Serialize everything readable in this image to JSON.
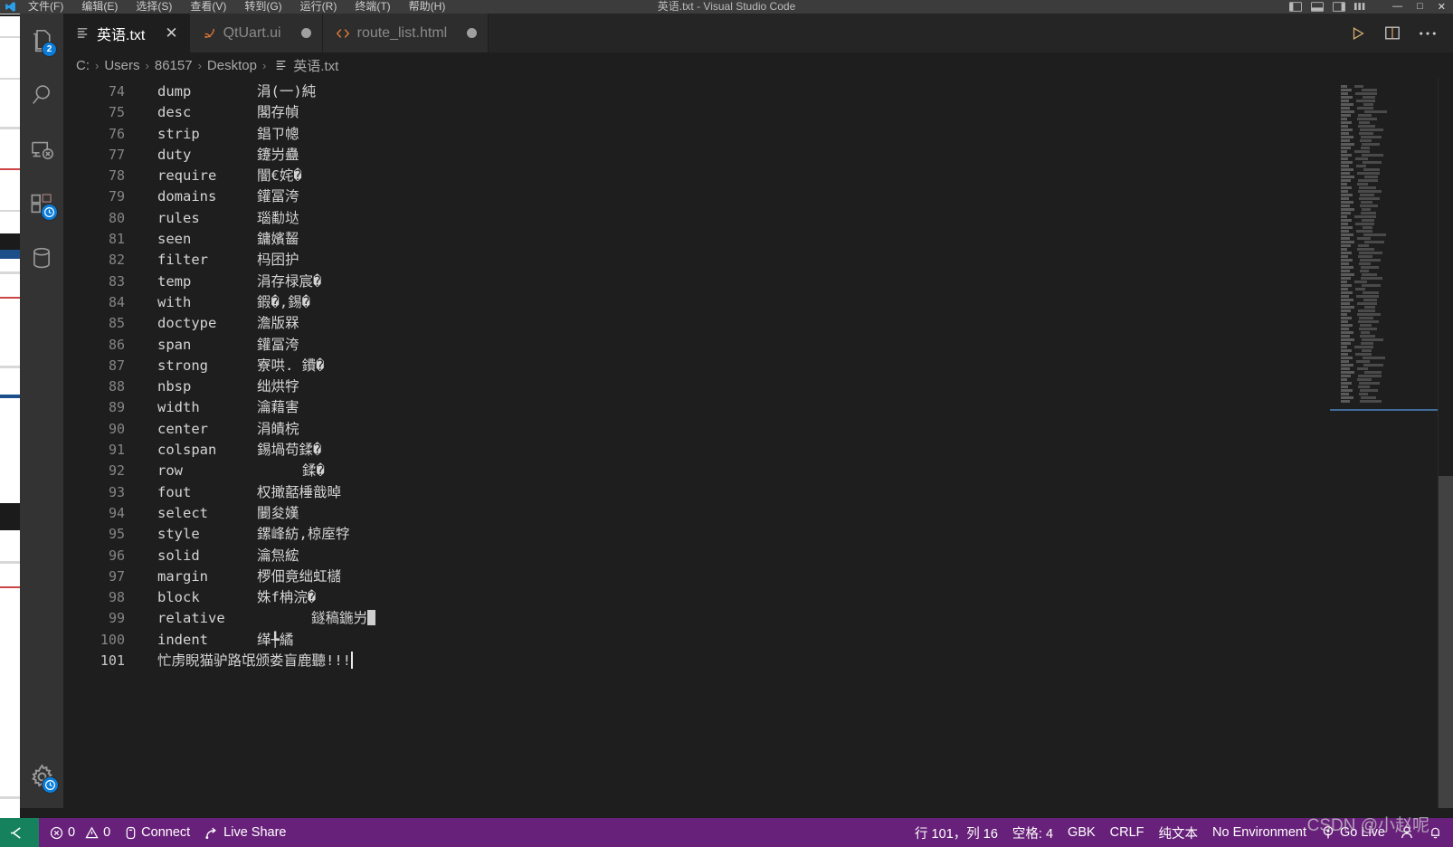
{
  "window": {
    "title": "英语.txt - Visual Studio Code",
    "menus": [
      "文件(F)",
      "编辑(E)",
      "选择(S)",
      "查看(V)",
      "转到(G)",
      "运行(R)",
      "终端(T)",
      "帮助(H)"
    ],
    "controls": {
      "minimize": "—",
      "maximize": "□",
      "close": "✕"
    }
  },
  "activitybar": {
    "items": [
      {
        "name": "explorer",
        "icon": "files-icon",
        "badge": "2"
      },
      {
        "name": "search",
        "icon": "search-icon",
        "badge": ""
      },
      {
        "name": "run-and-debug",
        "icon": "run-debug-icon",
        "badge": ""
      },
      {
        "name": "extensions",
        "icon": "extensions-icon",
        "badge": "clock"
      },
      {
        "name": "database",
        "icon": "database-icon",
        "badge": ""
      }
    ],
    "bottom": [
      {
        "name": "manage",
        "icon": "gear-icon",
        "badge": "clock"
      }
    ]
  },
  "tabs": [
    {
      "label": "英语.txt",
      "icon": "text-file-icon",
      "active": true,
      "dirty": false,
      "close": "✕"
    },
    {
      "label": "QtUart.ui",
      "icon": "ui-file-icon",
      "active": false,
      "dirty": true
    },
    {
      "label": "route_list.html",
      "icon": "html-file-icon",
      "active": false,
      "dirty": true
    }
  ],
  "tab_actions": [
    {
      "name": "run-button",
      "icon": "play-icon"
    },
    {
      "name": "split-editor-button",
      "icon": "split-icon"
    },
    {
      "name": "more-actions-button",
      "icon": "ellipsis-icon"
    }
  ],
  "breadcrumbs": {
    "separator": "›",
    "items": [
      "C:",
      "Users",
      "86157",
      "Desktop",
      "英语.txt"
    ]
  },
  "editor": {
    "first_line": 74,
    "lines": [
      {
        "n": 74,
        "word": "dump",
        "cn": "涓(一)純"
      },
      {
        "n": 75,
        "word": "desc",
        "cn": "閣存幀"
      },
      {
        "n": 76,
        "word": "strip",
        "cn": "錩ㄗ幒"
      },
      {
        "n": 77,
        "word": "duty",
        "cn": "鑳屶蠱"
      },
      {
        "n": 78,
        "word": "require",
        "cn": "闇€姹�"
      },
      {
        "n": 79,
        "word": "domains",
        "cn": "鑵冨洿"
      },
      {
        "n": 80,
        "word": "rules",
        "cn": "瑙勫垯"
      },
      {
        "n": 81,
        "word": "seen",
        "cn": "鏞嬪齧"
      },
      {
        "n": 82,
        "word": "filter",
        "cn": "杩囨护"
      },
      {
        "n": 83,
        "word": "temp",
        "cn": "涓存椂宸�"
      },
      {
        "n": 84,
        "word": "with",
        "cn": "鍜�,錫�"
      },
      {
        "n": 85,
        "word": "doctype",
        "cn": "澹版槑"
      },
      {
        "n": 86,
        "word": "span",
        "cn": "鑵冨洿"
      },
      {
        "n": 87,
        "word": "strong",
        "cn": "寮哄. 鐨�"
      },
      {
        "n": 88,
        "word": "nbsp",
        "cn": "绌烘牸"
      },
      {
        "n": 89,
        "word": "width",
        "cn": "瀹藉害"
      },
      {
        "n": 90,
        "word": "center",
        "cn": "涓皟梡"
      },
      {
        "n": 91,
        "word": "colspan",
        "cn": "錫堝苟鍒�"
      },
      {
        "n": 92,
        "word": "row",
        "cn": "鍒�",
        "indent": true
      },
      {
        "n": 93,
        "word": "fout",
        "cn": "权撖嚭棰戠晫"
      },
      {
        "n": 94,
        "word": "select",
        "cn": "闄夋嫨"
      },
      {
        "n": 95,
        "word": "style",
        "cn": "鏍峰紡,椋庢牸"
      },
      {
        "n": 96,
        "word": "solid",
        "cn": "瀹炰綋"
      },
      {
        "n": 97,
        "word": "margin",
        "cn": "椤佃竟绌虹櫧"
      },
      {
        "n": 98,
        "word": "block",
        "cn": "姝f柟浣�"
      },
      {
        "n": 99,
        "word": "relative",
        "cn": "鐩稿฀鍦屶",
        "indent2": true,
        "cursor_block": true
      },
      {
        "n": 100,
        "word": "indent",
        "cn": "缂╄繘"
      },
      {
        "n": 101,
        "word": "",
        "cn": "忙虏睨猫驴路氓颁娄盲鹿聽!!!",
        "is_current": true,
        "caret": true
      }
    ]
  },
  "statusbar": {
    "left": [
      {
        "name": "remote-indicator",
        "icon": "remote-icon",
        "label": ""
      },
      {
        "name": "problems",
        "icon": "error-warning-icon",
        "label": "0  0",
        "errors": "0",
        "warnings": "0"
      },
      {
        "name": "connect",
        "icon": "db-icon",
        "label": "Connect"
      },
      {
        "name": "live-share",
        "icon": "live-share-icon",
        "label": "Live Share"
      }
    ],
    "right": [
      {
        "name": "cursor-position",
        "label": "行 101，列 16"
      },
      {
        "name": "indentation",
        "label": "空格: 4"
      },
      {
        "name": "encoding",
        "label": "GBK"
      },
      {
        "name": "eol",
        "label": "CRLF"
      },
      {
        "name": "language-mode",
        "label": "纯文本"
      },
      {
        "name": "environment",
        "label": "No Environment"
      },
      {
        "name": "go-live",
        "icon": "broadcast-icon",
        "label": "Go Live"
      },
      {
        "name": "accounts",
        "icon": "account-icon",
        "label": ""
      },
      {
        "name": "notifications",
        "icon": "bell-icon",
        "label": ""
      }
    ]
  },
  "watermark": {
    "text": "CSDN @小赵呢"
  },
  "colors": {
    "titlebar": "#3c3c3c",
    "activitybar": "#333333",
    "editor_bg": "#1e1e1e",
    "tab_inactive": "#2d2d2d",
    "statusbar": "#68217a",
    "remote_green": "#16825d",
    "badge_blue": "#0a7ddb",
    "accent_orange": "#e37933",
    "line_number": "#858585",
    "text": "#d4d4d4"
  }
}
